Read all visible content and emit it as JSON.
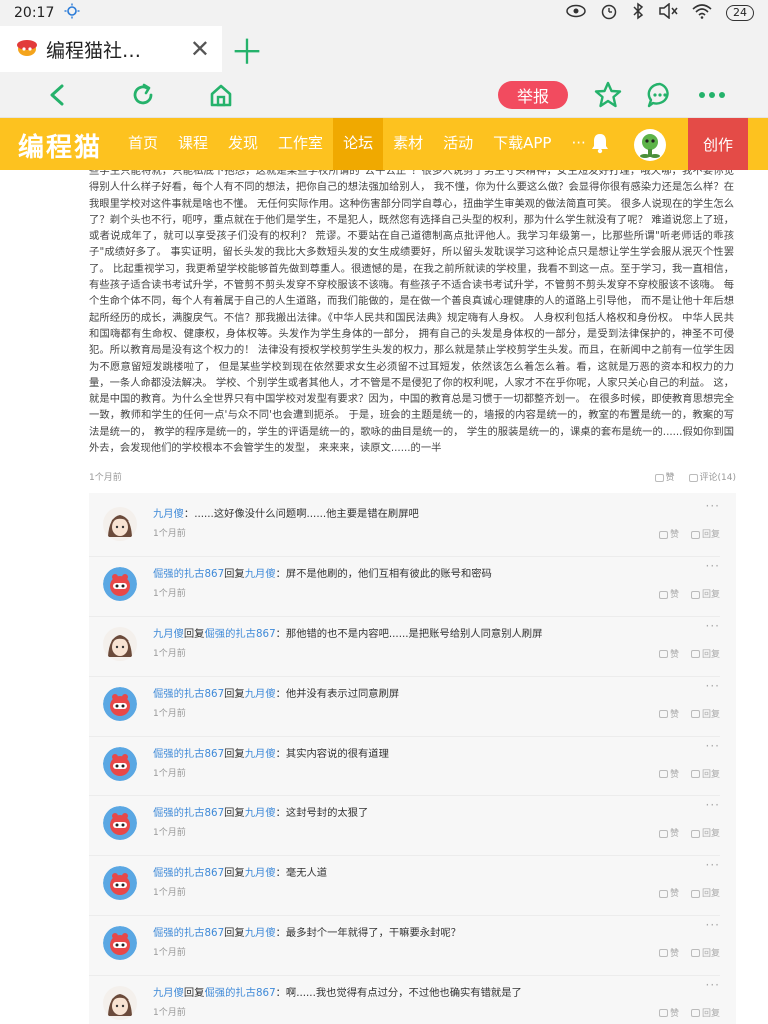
{
  "status": {
    "time": "20:17",
    "battery": "24"
  },
  "tab": {
    "title": "编程猫社…"
  },
  "navbar": {
    "report_label": "举报"
  },
  "header": {
    "logo": "编程猫",
    "menu": [
      "首页",
      "课程",
      "发现",
      "工作室",
      "论坛",
      "素材",
      "活动",
      "下载APP",
      "···"
    ],
    "active_index": 4,
    "create_label": "创作"
  },
  "post": {
    "text": "些学生只能将就，只能私底下抱怨，这就是某些学校所谓的\"公平公正\"？很多人说剪了男生寸头精神，女生短发好打理，哦天哪，我不要你觉得别人什么样子好看，每个人有不同的想法，把你自己的想法强加给别人， 我不懂，你为什么要这么做？会显得你很有感染力还是怎么样？在我眼里学校对这件事就是啥也不懂。 无任何实际作用。这种伤害部分同学自尊心，扭曲学生审美观的做法简直可笑。 很多人说现在的学生怎么了？剃个头也不行，呃哼，重点就在于他们是学生，不是犯人，既然您有选择自己头型的权利，那为什么学生就没有了呢？ 难道说您上了班，或者说成年了，就可以享受孩子们没有的权利？ 荒谬。不要站在自己道德制高点批评他人。我学习年级第一，比那些所谓\"听老师话的乖孩子\"成绩好多了。 事实证明，留长头发的我比大多数短头发的女生成绩要好，所以留头发耽误学习这种论点只是想让学生学会服从泯灭个性罢了。 比起重视学习，我更希望学校能够首先做到尊重人。很遗憾的是，在我之前所就读的学校里，我看不到这一点。至于学习，我一直相信， 有些孩子适合读书考试升学，不管剪不剪头发穿不穿校服该不该嗨。有些孩子不适合读书考试升学，不管剪不剪头发穿不穿校服该不该嗨。 每个生命个体不同，每个人有着属于自己的人生道路，而我们能做的，是在做一个善良真诚心理健康的人的道路上引导他， 而不是让他十年后想起所经历的成长，满腹戾气。不信？那我搬出法律。《中华人民共和国民法典》规定嗨有人身权。 人身权利包括人格权和身份权。 中华人民共和国嗨都有生命权、健康权，身体权等。头发作为学生身体的一部分， 拥有自己的头发是身体权的一部分，是受到法律保护的，神圣不可侵犯。所以教育局是没有这个权力的！ 法律没有授权学校剪学生头发的权力，那么就是禁止学校剪学生头发。而且，在新闻中之前有一位学生因为不愿意留短发跳楼啦了， 但是某些学校到现在依然要求女生必须留不过耳短发，依然该怎么着怎么着。看，这就是万恶的资本和权力的力量，一条人命都没法解决。 学校、个别学生或者其他人，才不管是不是侵犯了你的权利呢，人家才不在乎你呢，人家只关心自己的利益。 这，就是中国的教育。为什么全世界只有中国学校对发型有要求？因为，中国的教育总是习惯于一切都整齐划一。 在很多时候，即使教育思想完全一致，教师和学生的任何一点'与众不同'也会遭到扼杀。 于是，班会的主题是统一的，墙报的内容是统一的，教室的布置是统一的，教案的写法是统一的， 教学的程序是统一的，学生的评语是统一的，歌咏的曲目是统一的， 学生的服装是统一的，课桌的套布是统一的......假如你到国外去，会发现他们的学校根本不会管学生的发型，       来来来，读原文......的一半",
    "time": "1个月前",
    "like_label": "赞",
    "comment_label": "评论(14)"
  },
  "replies": [
    {
      "user": "九月傻",
      "to": "",
      "text": "......这好像没什么问题啊......他主要是错在刷屏吧",
      "time": "1个月前",
      "avatar": "boy"
    },
    {
      "user": "倔强的扎古867",
      "to": "九月傻",
      "text": "屏不是他刷的，他们互相有彼此的账号和密码",
      "time": "1个月前",
      "avatar": "robot"
    },
    {
      "user": "九月傻",
      "to": "倔强的扎古867",
      "text": "那他错的也不是内容吧......是把账号给别人同意别人刷屏",
      "time": "1个月前",
      "avatar": "boy"
    },
    {
      "user": "倔强的扎古867",
      "to": "九月傻",
      "text": "他并没有表示过同意刷屏",
      "time": "1个月前",
      "avatar": "robot"
    },
    {
      "user": "倔强的扎古867",
      "to": "九月傻",
      "text": "其实内容说的很有道理",
      "time": "1个月前",
      "avatar": "robot"
    },
    {
      "user": "倔强的扎古867",
      "to": "九月傻",
      "text": "这封号封的太狠了",
      "time": "1个月前",
      "avatar": "robot"
    },
    {
      "user": "倔强的扎古867",
      "to": "九月傻",
      "text": "毫无人道",
      "time": "1个月前",
      "avatar": "robot"
    },
    {
      "user": "倔强的扎古867",
      "to": "九月傻",
      "text": "最多封个一年就得了，干嘛要永封呢？",
      "time": "1个月前",
      "avatar": "robot"
    },
    {
      "user": "九月傻",
      "to": "倔强的扎古867",
      "text": "啊......我也觉得有点过分，不过他也确实有错就是了",
      "time": "1个月前",
      "avatar": "boy"
    }
  ],
  "labels": {
    "reply_word": "回复",
    "like": "赞",
    "reply": "回复",
    "more": "···"
  },
  "colors": {
    "brand": "#fdc21f",
    "create": "#e44b47",
    "report": "#f24b5f",
    "link": "#3f8ad8",
    "green": "#25b26b"
  }
}
